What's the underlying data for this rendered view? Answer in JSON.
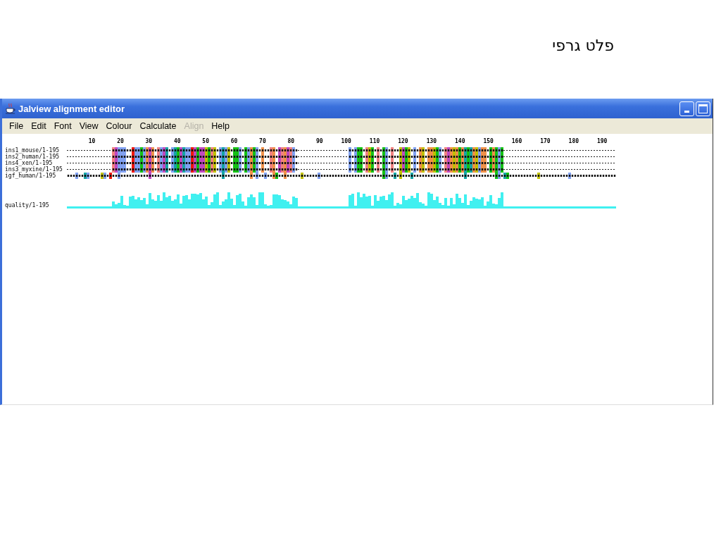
{
  "slide_title": "פלט גרפי",
  "window": {
    "title": "Jalview alignment editor"
  },
  "menu": [
    {
      "label": "File",
      "disabled": false
    },
    {
      "label": "Edit",
      "disabled": false
    },
    {
      "label": "Font",
      "disabled": false
    },
    {
      "label": "View",
      "disabled": false
    },
    {
      "label": "Colour",
      "disabled": false
    },
    {
      "label": "Calculate",
      "disabled": false
    },
    {
      "label": "Align",
      "disabled": true
    },
    {
      "label": "Help",
      "disabled": false
    }
  ],
  "ruler": [
    "10",
    "20",
    "30",
    "40",
    "50",
    "60",
    "70",
    "80",
    "90",
    "100",
    "110",
    "120",
    "130",
    "140",
    "150",
    "160",
    "170",
    "180",
    "190"
  ],
  "sequences": [
    {
      "name": "ins1_mouse/1-195"
    },
    {
      "name": "ins2_human/1-195"
    },
    {
      "name": "ins4_xen/1-195"
    },
    {
      "name": "ins3_myxine/1-195"
    },
    {
      "name": "igf_human/1-195"
    }
  ],
  "annotation": {
    "name": "quality/1-195"
  }
}
